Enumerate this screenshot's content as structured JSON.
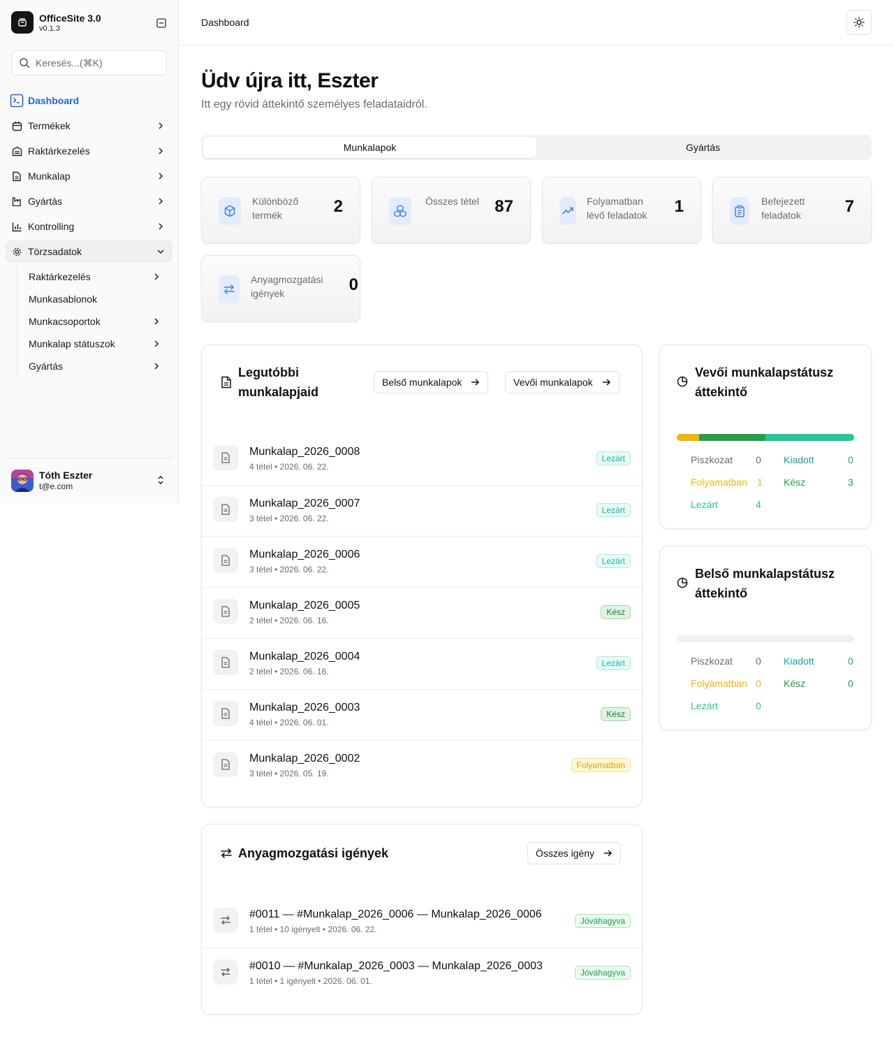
{
  "brand": {
    "name": "OfficeSite 3.0",
    "version": "v0.1.3"
  },
  "search": {
    "placeholder": "Keresés...(⌘K)"
  },
  "nav": {
    "items": [
      {
        "label": "Dashboard"
      },
      {
        "label": "Termékek"
      },
      {
        "label": "Raktárkezelés"
      },
      {
        "label": "Munkalap"
      },
      {
        "label": "Gyártás"
      },
      {
        "label": "Kontrolling"
      },
      {
        "label": "Törzsadatok"
      }
    ],
    "sub": [
      {
        "label": "Raktárkezelés"
      },
      {
        "label": "Munkasablonok"
      },
      {
        "label": "Munkacsoportok"
      },
      {
        "label": "Munkalap státuszok"
      },
      {
        "label": "Gyártás"
      }
    ]
  },
  "user": {
    "name": "Tóth Eszter",
    "email": "t@e.com"
  },
  "header": {
    "breadcrumb": "Dashboard"
  },
  "welcome": {
    "title": "Üdv újra itt, Eszter",
    "subtitle": "Itt egy rövid áttekintő személyes feladataidról."
  },
  "tabs": [
    {
      "label": "Munkalapok"
    },
    {
      "label": "Gyártás"
    }
  ],
  "stats": [
    {
      "label": "Különböző termék",
      "value": "2"
    },
    {
      "label": "Összes tétel",
      "value": "87"
    },
    {
      "label": "Folyamatban lévő feladatok",
      "value": "1"
    },
    {
      "label": "Befejezett feladatok",
      "value": "7"
    },
    {
      "label": "Anyagmozgatási igények",
      "value": "0"
    }
  ],
  "recent": {
    "title": "Legutóbbi munkalapjaid",
    "btn_internal": "Belső munkalapok",
    "btn_customer": "Vevői munkalapok",
    "rows": [
      {
        "title": "Munkalap_2026_0008",
        "sub": "4 tétel • 2026. 06. 22.",
        "status": "Lezárt"
      },
      {
        "title": "Munkalap_2026_0007",
        "sub": "3 tétel • 2026. 06. 22.",
        "status": "Lezárt"
      },
      {
        "title": "Munkalap_2026_0006",
        "sub": "3 tétel • 2026. 06. 22.",
        "status": "Lezárt"
      },
      {
        "title": "Munkalap_2026_0005",
        "sub": "2 tétel • 2026. 06. 16.",
        "status": "Kész"
      },
      {
        "title": "Munkalap_2026_0004",
        "sub": "2 tétel • 2026. 06. 16.",
        "status": "Lezárt"
      },
      {
        "title": "Munkalap_2026_0003",
        "sub": "4 tétel • 2026. 06. 01.",
        "status": "Kész"
      },
      {
        "title": "Munkalap_2026_0002",
        "sub": "3 tétel • 2026. 05. 19.",
        "status": "Folyamatban"
      }
    ]
  },
  "material": {
    "title": "Anyagmozgatási igények",
    "btn_all": "Összes igény",
    "rows": [
      {
        "title": "#0011 — #Munkalap_2026_0006 — Munkalap_2026_0006",
        "sub": "1 tétel • 10 igényelt • 2026. 06. 22.",
        "status": "Jóváhagyva"
      },
      {
        "title": "#0010 — #Munkalap_2026_0003 — Munkalap_2026_0003",
        "sub": "1 tétel • 1 igényelt • 2026. 06. 01.",
        "status": "Jóváhagyva"
      }
    ]
  },
  "customer_status": {
    "title": "Vevői munkalapstátusz áttekintő",
    "bar": [
      {
        "name": "Folyamatban",
        "share": 0.125
      },
      {
        "name": "Kész",
        "share": 0.375
      },
      {
        "name": "Lezárt",
        "share": 0.5
      }
    ],
    "piszkozat_label": "Piszkozat",
    "piszkozat": "0",
    "kiadott_label": "Kiadott",
    "kiadott": "0",
    "folyamatban_label": "Folyamatban",
    "folyamatban": "1",
    "kesz_label": "Kész",
    "kesz": "3",
    "lezart_label": "Lezárt",
    "lezart": "4"
  },
  "internal_status": {
    "title": "Belső munkalapstátusz áttekintő",
    "piszkozat_label": "Piszkozat",
    "piszkozat": "0",
    "kiadott_label": "Kiadott",
    "kiadott": "0",
    "folyamatban_label": "Folyamatban",
    "folyamatban": "0",
    "kesz_label": "Kész",
    "kesz": "0",
    "lezart_label": "Lezárt",
    "lezart": "0"
  },
  "colors": {
    "accent": "#2563eb",
    "folyamatban": "#f5b400",
    "kesz": "#22a045",
    "lezart": "#1ec99a",
    "kiadott": "#14a3a3"
  }
}
